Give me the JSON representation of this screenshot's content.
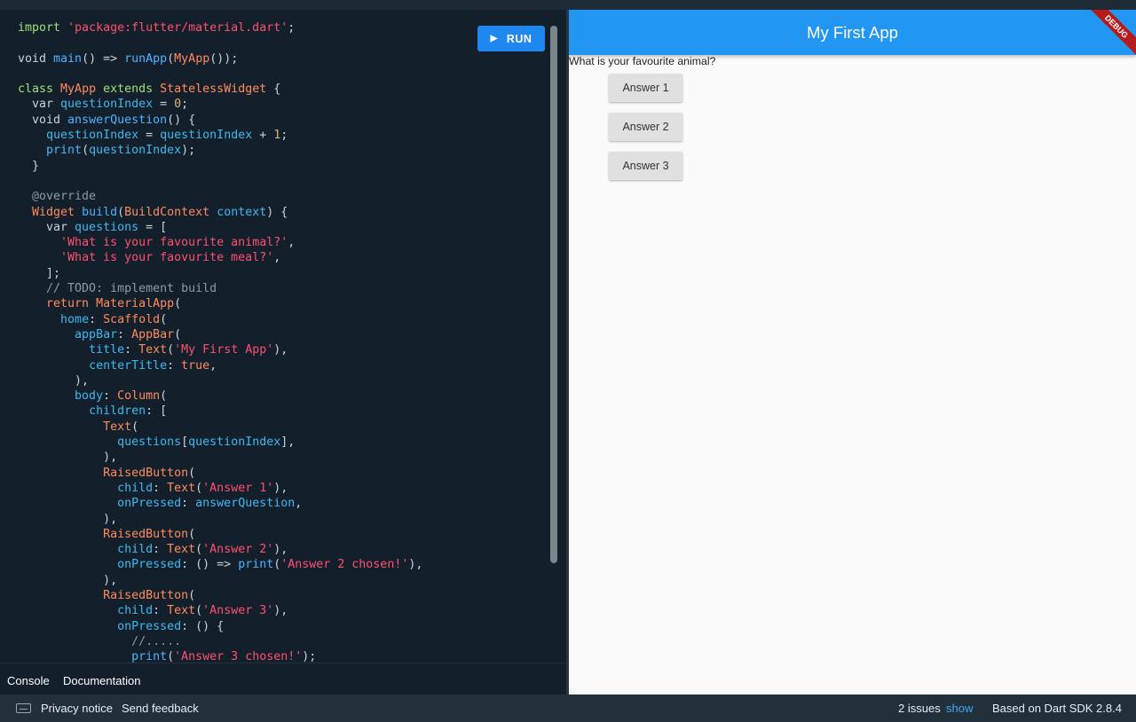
{
  "editor": {
    "run_label": "RUN",
    "code_lines": [
      [
        [
          "kw",
          "import "
        ],
        [
          "str",
          "'package:flutter/material.dart'"
        ],
        [
          "p",
          ";"
        ]
      ],
      [],
      [
        [
          "p",
          "void "
        ],
        [
          "fn",
          "main"
        ],
        [
          "p",
          "() => "
        ],
        [
          "fn",
          "runApp"
        ],
        [
          "p",
          "("
        ],
        [
          "cls",
          "MyApp"
        ],
        [
          "p",
          "());"
        ]
      ],
      [],
      [
        [
          "kw",
          "class "
        ],
        [
          "cls",
          "MyApp "
        ],
        [
          "kw",
          "extends "
        ],
        [
          "cls",
          "StatelessWidget"
        ],
        [
          "p",
          " {"
        ]
      ],
      [
        [
          "p",
          "  var "
        ],
        [
          "id",
          "questionIndex"
        ],
        [
          "p",
          " = "
        ],
        [
          "num",
          "0"
        ],
        [
          "p",
          ";"
        ]
      ],
      [
        [
          "p",
          "  void "
        ],
        [
          "fn",
          "answerQuestion"
        ],
        [
          "p",
          "() {"
        ]
      ],
      [
        [
          "p",
          "    "
        ],
        [
          "id",
          "questionIndex"
        ],
        [
          "p",
          " = "
        ],
        [
          "id",
          "questionIndex"
        ],
        [
          "p",
          " + "
        ],
        [
          "num",
          "1"
        ],
        [
          "p",
          ";"
        ]
      ],
      [
        [
          "p",
          "    "
        ],
        [
          "fn",
          "print"
        ],
        [
          "p",
          "("
        ],
        [
          "id",
          "questionIndex"
        ],
        [
          "p",
          ");"
        ]
      ],
      [
        [
          "p",
          "  }"
        ]
      ],
      [],
      [
        [
          "cm",
          "  @override"
        ]
      ],
      [
        [
          "p",
          "  "
        ],
        [
          "cls",
          "Widget "
        ],
        [
          "fn",
          "build"
        ],
        [
          "p",
          "("
        ],
        [
          "cls",
          "BuildContext "
        ],
        [
          "id",
          "context"
        ],
        [
          "p",
          ") {"
        ]
      ],
      [
        [
          "p",
          "    var "
        ],
        [
          "id",
          "questions"
        ],
        [
          "p",
          " = ["
        ]
      ],
      [
        [
          "p",
          "      "
        ],
        [
          "str",
          "'What is your favourite animal?'"
        ],
        [
          "p",
          ","
        ]
      ],
      [
        [
          "p",
          "      "
        ],
        [
          "str",
          "'What is your faovurite meal?'"
        ],
        [
          "p",
          ","
        ]
      ],
      [
        [
          "p",
          "    ];"
        ]
      ],
      [
        [
          "cm",
          "    // TODO: implement build"
        ]
      ],
      [
        [
          "p",
          "    "
        ],
        [
          "cls",
          "return "
        ],
        [
          "cls",
          "MaterialApp"
        ],
        [
          "p",
          "("
        ]
      ],
      [
        [
          "p",
          "      "
        ],
        [
          "id",
          "home"
        ],
        [
          "p",
          ": "
        ],
        [
          "cls",
          "Scaffold"
        ],
        [
          "p",
          "("
        ]
      ],
      [
        [
          "p",
          "        "
        ],
        [
          "id",
          "appBar"
        ],
        [
          "p",
          ": "
        ],
        [
          "cls",
          "AppBar"
        ],
        [
          "p",
          "("
        ]
      ],
      [
        [
          "p",
          "          "
        ],
        [
          "id",
          "title"
        ],
        [
          "p",
          ": "
        ],
        [
          "cls",
          "Text"
        ],
        [
          "p",
          "("
        ],
        [
          "str",
          "'My First App'"
        ],
        [
          "p",
          "),"
        ]
      ],
      [
        [
          "p",
          "          "
        ],
        [
          "id",
          "centerTitle"
        ],
        [
          "p",
          ": "
        ],
        [
          "cls",
          "true"
        ],
        [
          "p",
          ","
        ]
      ],
      [
        [
          "p",
          "        ),"
        ]
      ],
      [
        [
          "p",
          "        "
        ],
        [
          "id",
          "body"
        ],
        [
          "p",
          ": "
        ],
        [
          "cls",
          "Column"
        ],
        [
          "p",
          "("
        ]
      ],
      [
        [
          "p",
          "          "
        ],
        [
          "id",
          "children"
        ],
        [
          "p",
          ": ["
        ]
      ],
      [
        [
          "p",
          "            "
        ],
        [
          "cls",
          "Text"
        ],
        [
          "p",
          "("
        ]
      ],
      [
        [
          "p",
          "              "
        ],
        [
          "id",
          "questions"
        ],
        [
          "p",
          "["
        ],
        [
          "id",
          "questionIndex"
        ],
        [
          "p",
          "],"
        ]
      ],
      [
        [
          "p",
          "            ),"
        ]
      ],
      [
        [
          "p",
          "            "
        ],
        [
          "cls",
          "RaisedButton"
        ],
        [
          "p",
          "("
        ]
      ],
      [
        [
          "p",
          "              "
        ],
        [
          "id",
          "child"
        ],
        [
          "p",
          ": "
        ],
        [
          "cls",
          "Text"
        ],
        [
          "p",
          "("
        ],
        [
          "str",
          "'Answer 1'"
        ],
        [
          "p",
          "),"
        ]
      ],
      [
        [
          "p",
          "              "
        ],
        [
          "id",
          "onPressed"
        ],
        [
          "p",
          ": "
        ],
        [
          "id",
          "answerQuestion"
        ],
        [
          "p",
          ","
        ]
      ],
      [
        [
          "p",
          "            ),"
        ]
      ],
      [
        [
          "p",
          "            "
        ],
        [
          "cls",
          "RaisedButton"
        ],
        [
          "p",
          "("
        ]
      ],
      [
        [
          "p",
          "              "
        ],
        [
          "id",
          "child"
        ],
        [
          "p",
          ": "
        ],
        [
          "cls",
          "Text"
        ],
        [
          "p",
          "("
        ],
        [
          "str",
          "'Answer 2'"
        ],
        [
          "p",
          "),"
        ]
      ],
      [
        [
          "p",
          "              "
        ],
        [
          "id",
          "onPressed"
        ],
        [
          "p",
          ": () => "
        ],
        [
          "fn",
          "print"
        ],
        [
          "p",
          "("
        ],
        [
          "str",
          "'Answer 2 chosen!'"
        ],
        [
          "p",
          "),"
        ]
      ],
      [
        [
          "p",
          "            ),"
        ]
      ],
      [
        [
          "p",
          "            "
        ],
        [
          "cls",
          "RaisedButton"
        ],
        [
          "p",
          "("
        ]
      ],
      [
        [
          "p",
          "              "
        ],
        [
          "id",
          "child"
        ],
        [
          "p",
          ": "
        ],
        [
          "cls",
          "Text"
        ],
        [
          "p",
          "("
        ],
        [
          "str",
          "'Answer 3'"
        ],
        [
          "p",
          "),"
        ]
      ],
      [
        [
          "p",
          "              "
        ],
        [
          "id",
          "onPressed"
        ],
        [
          "p",
          ": () {"
        ]
      ],
      [
        [
          "cm",
          "                //....."
        ]
      ],
      [
        [
          "p",
          "                "
        ],
        [
          "fn",
          "print"
        ],
        [
          "p",
          "("
        ],
        [
          "str",
          "'Answer 3 chosen!'"
        ],
        [
          "p",
          ");"
        ]
      ]
    ]
  },
  "tabs": {
    "console": "Console",
    "documentation": "Documentation"
  },
  "status": {
    "privacy": "Privacy notice",
    "feedback": "Send feedback",
    "issues": "2 issues",
    "show": "show",
    "sdk": "Based on Dart SDK 2.8.4"
  },
  "preview": {
    "app_title": "My First App",
    "debug_banner": "DEBUG",
    "question": "What is your favourite animal?",
    "answers": [
      "Answer 1",
      "Answer 2",
      "Answer 3"
    ]
  },
  "colors": {
    "accent": "#1f87f0",
    "appbar": "#2196f3",
    "editor_bg": "#13202c",
    "link": "#42a5f5"
  }
}
